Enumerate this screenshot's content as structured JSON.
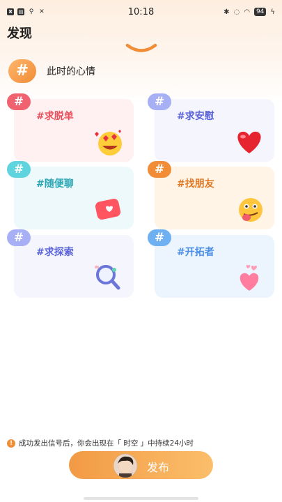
{
  "status_bar": {
    "time": "10:18",
    "battery": "94",
    "left_icons": [
      "app-icon-1",
      "app-icon-2",
      "usb-icon",
      "tools-icon"
    ],
    "right_icons": [
      "bluetooth-icon",
      "mute-icon",
      "wifi-icon",
      "battery-icon",
      "charging-icon"
    ]
  },
  "header": {
    "title": "发现",
    "collapse_icon": "chevron-down-icon"
  },
  "mood": {
    "badge": "#",
    "label": "此时的心情"
  },
  "topics": [
    {
      "badge": "#",
      "label": "#求脱单",
      "label_color": "#e8505b",
      "badge_color": "#f06270",
      "bg": "#fff0f2",
      "art": "heart-eyes-emoji"
    },
    {
      "badge": "#",
      "label": "#求安慰",
      "label_color": "#5b64d8",
      "badge_color": "#a7b0f5",
      "bg": "#f4f5fd",
      "art": "red-heart"
    },
    {
      "badge": "#",
      "label": "#随便聊",
      "label_color": "#2aa6b5",
      "badge_color": "#5fd4df",
      "bg": "#edf9fa",
      "art": "chat-bubble-heart"
    },
    {
      "badge": "#",
      "label": "#找朋友",
      "label_color": "#e07a26",
      "badge_color": "#f08d36",
      "bg": "#fff4e6",
      "art": "tongue-emoji"
    },
    {
      "badge": "#",
      "label": "#求探索",
      "label_color": "#5b64d8",
      "badge_color": "#a7b0f5",
      "bg": "#f5f5fd",
      "art": "magnifier"
    },
    {
      "badge": "#",
      "label": "#开拓者",
      "label_color": "#4b8ee6",
      "badge_color": "#6fb0f2",
      "bg": "#ecf5fd",
      "art": "pink-hearts"
    }
  ],
  "notice": {
    "text": "成功发出信号后，你会出现在「 时空 」中持续24小时",
    "icon": "info-icon"
  },
  "publish": {
    "label": "发布"
  },
  "colors": {
    "accent": "#f08d36"
  }
}
